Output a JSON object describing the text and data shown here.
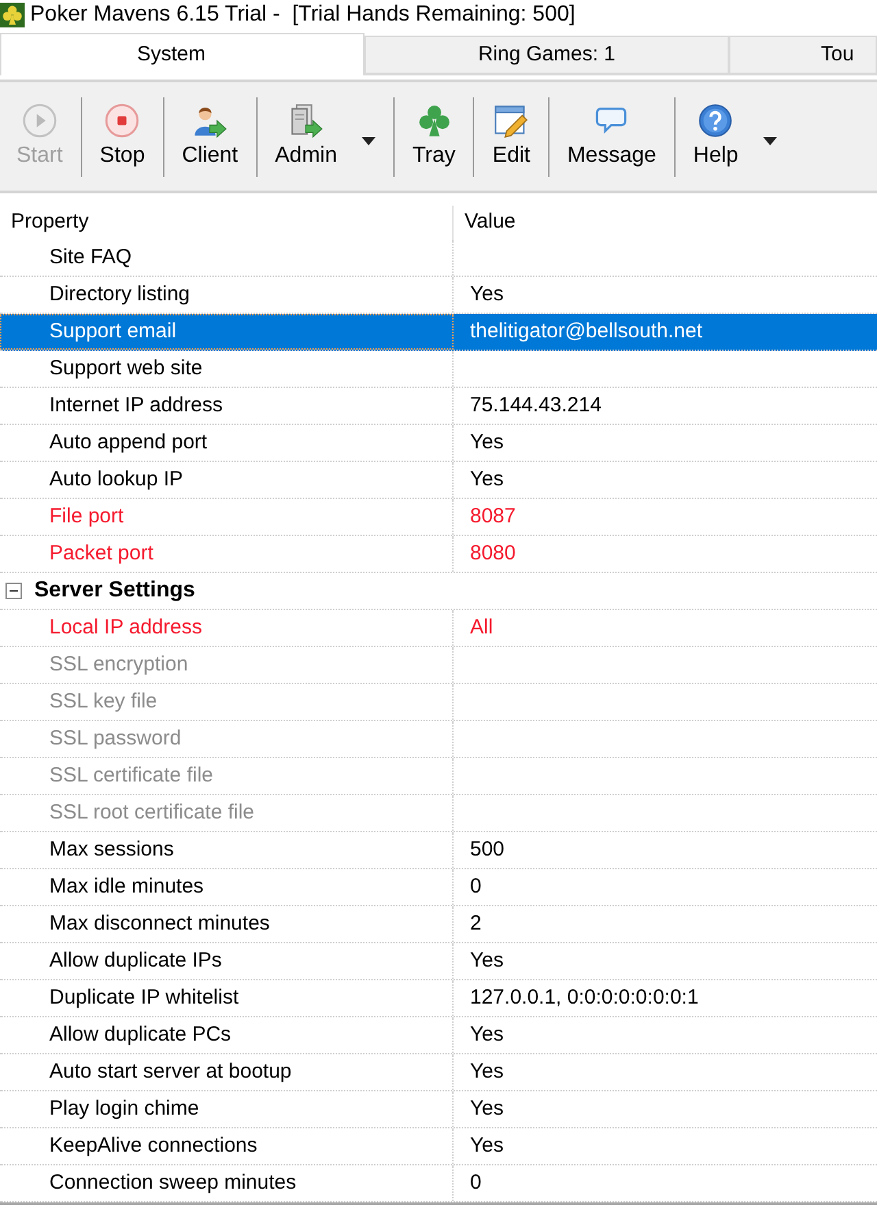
{
  "window": {
    "title": "Poker Mavens 6.15 Trial -  [Trial Hands Remaining: 500]"
  },
  "tabs": [
    {
      "label": "System",
      "selected": true
    },
    {
      "label": "Ring Games: 1",
      "selected": false
    },
    {
      "label": "Tou",
      "selected": false
    }
  ],
  "toolbar": {
    "buttons": [
      {
        "label": "Start",
        "disabled": true,
        "dropdown": false
      },
      {
        "label": "Stop",
        "disabled": false,
        "dropdown": false
      },
      {
        "label": "Client",
        "disabled": false,
        "dropdown": false
      },
      {
        "label": "Admin",
        "disabled": false,
        "dropdown": true
      },
      {
        "label": "Tray",
        "disabled": false,
        "dropdown": false
      },
      {
        "label": "Edit",
        "disabled": false,
        "dropdown": false
      },
      {
        "label": "Message",
        "disabled": false,
        "dropdown": false
      },
      {
        "label": "Help",
        "disabled": false,
        "dropdown": true
      }
    ]
  },
  "grid": {
    "columns": [
      "Property",
      "Value"
    ],
    "rows": [
      {
        "kind": "property",
        "name": "Site FAQ",
        "selected": false,
        "highlighted": false,
        "disabled": false
      },
      {
        "kind": "property",
        "name": "Directory listing",
        "value": "Yes",
        "selected": false,
        "highlighted": false,
        "disabled": false
      },
      {
        "kind": "property",
        "name": "Support email",
        "value": "thelitigator@bellsouth.net",
        "selected": true,
        "highlighted": false,
        "disabled": false
      },
      {
        "kind": "property",
        "name": "Support web site",
        "selected": false,
        "highlighted": false,
        "disabled": false
      },
      {
        "kind": "property",
        "name": "Internet IP address",
        "value": "75.144.43.214",
        "selected": false,
        "highlighted": false,
        "disabled": false
      },
      {
        "kind": "property",
        "name": "Auto append port",
        "value": "Yes",
        "selected": false,
        "highlighted": false,
        "disabled": false
      },
      {
        "kind": "property",
        "name": "Auto lookup IP",
        "value": "Yes",
        "selected": false,
        "highlighted": false,
        "disabled": false
      },
      {
        "kind": "property",
        "name": "File port",
        "value": "8087",
        "selected": false,
        "highlighted": true,
        "disabled": false
      },
      {
        "kind": "property",
        "name": "Packet port",
        "value": "8080",
        "selected": false,
        "highlighted": true,
        "disabled": false
      },
      {
        "kind": "category",
        "name": "Server Settings",
        "expanded": true,
        "selected": false,
        "children": [
          {
            "kind": "property",
            "name": "Local IP address",
            "value": "All",
            "selected": false,
            "highlighted": true,
            "disabled": false
          },
          {
            "kind": "property",
            "name": "SSL encryption",
            "selected": false,
            "highlighted": false,
            "disabled": true
          },
          {
            "kind": "property",
            "name": "SSL key file",
            "selected": false,
            "highlighted": false,
            "disabled": true
          },
          {
            "kind": "property",
            "name": "SSL password",
            "selected": false,
            "highlighted": false,
            "disabled": true
          },
          {
            "kind": "property",
            "name": "SSL certificate file",
            "selected": false,
            "highlighted": false,
            "disabled": true
          },
          {
            "kind": "property",
            "name": "SSL root certificate file",
            "selected": false,
            "highlighted": false,
            "disabled": true
          },
          {
            "kind": "property",
            "name": "Max sessions",
            "value": "500",
            "selected": false,
            "highlighted": false,
            "disabled": false
          },
          {
            "kind": "property",
            "name": "Max idle minutes",
            "value": "0",
            "selected": false,
            "highlighted": false,
            "disabled": false
          },
          {
            "kind": "property",
            "name": "Max disconnect minutes",
            "value": "2",
            "selected": false,
            "highlighted": false,
            "disabled": false
          },
          {
            "kind": "property",
            "name": "Allow duplicate IPs",
            "value": "Yes",
            "selected": false,
            "highlighted": false,
            "disabled": false
          },
          {
            "kind": "property",
            "name": "Duplicate IP whitelist",
            "value": "127.0.0.1, 0:0:0:0:0:0:0:1",
            "selected": false,
            "highlighted": false,
            "disabled": false
          },
          {
            "kind": "property",
            "name": "Allow duplicate PCs",
            "value": "Yes",
            "selected": false,
            "highlighted": false,
            "disabled": false
          },
          {
            "kind": "property",
            "name": "Auto start server at bootup",
            "value": "Yes",
            "selected": false,
            "highlighted": false,
            "disabled": false
          },
          {
            "kind": "property",
            "name": "Play login chime",
            "value": "Yes",
            "selected": false,
            "highlighted": false,
            "disabled": false
          },
          {
            "kind": "property",
            "name": "KeepAlive connections",
            "value": "Yes",
            "selected": false,
            "highlighted": false,
            "disabled": false
          },
          {
            "kind": "property",
            "name": "Connection sweep minutes",
            "value": "0",
            "selected": false,
            "highlighted": false,
            "disabled": false
          }
        ]
      }
    ]
  }
}
